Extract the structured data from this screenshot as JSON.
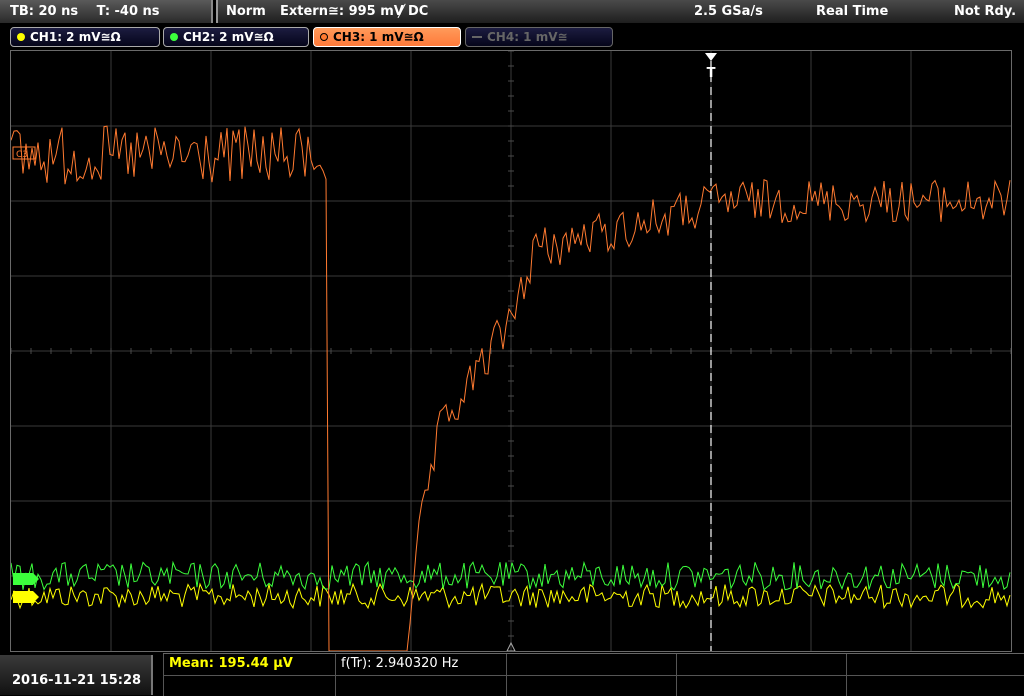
{
  "top": {
    "timebase": "TB: 20 ns",
    "trigger_time": "T: -40 ns",
    "trigger_mode": "Norm",
    "trigger_source": "Extern≅: 995 mV",
    "trigger_slope": "DC",
    "sample_rate": "2.5 GSa/s",
    "acq_mode": "Real Time",
    "status": "Not Rdy."
  },
  "channels": [
    {
      "label": "CH1: 2 mV≅Ω",
      "color": "#ffff00",
      "state": "on"
    },
    {
      "label": "CH2: 2 mV≅Ω",
      "color": "#3cff3c",
      "state": "on"
    },
    {
      "label": "CH3: 1 mV≅Ω",
      "color": "#ff7a30",
      "state": "active"
    },
    {
      "label": "CH4: 1 mV≅",
      "color": "#666666",
      "state": "off"
    }
  ],
  "markers": {
    "ch3": "C3",
    "trigger": "T"
  },
  "bottom": {
    "datetime": "2016-11-21 15:28",
    "meas1": "Mean: 195.44 µV",
    "meas2": "f(Tr): 2.940320 Hz"
  },
  "colors": {
    "ch1": "#ffff00",
    "ch2": "#3cff3c",
    "ch3": "#ff7a30",
    "grid": "#3a3a3a"
  }
}
